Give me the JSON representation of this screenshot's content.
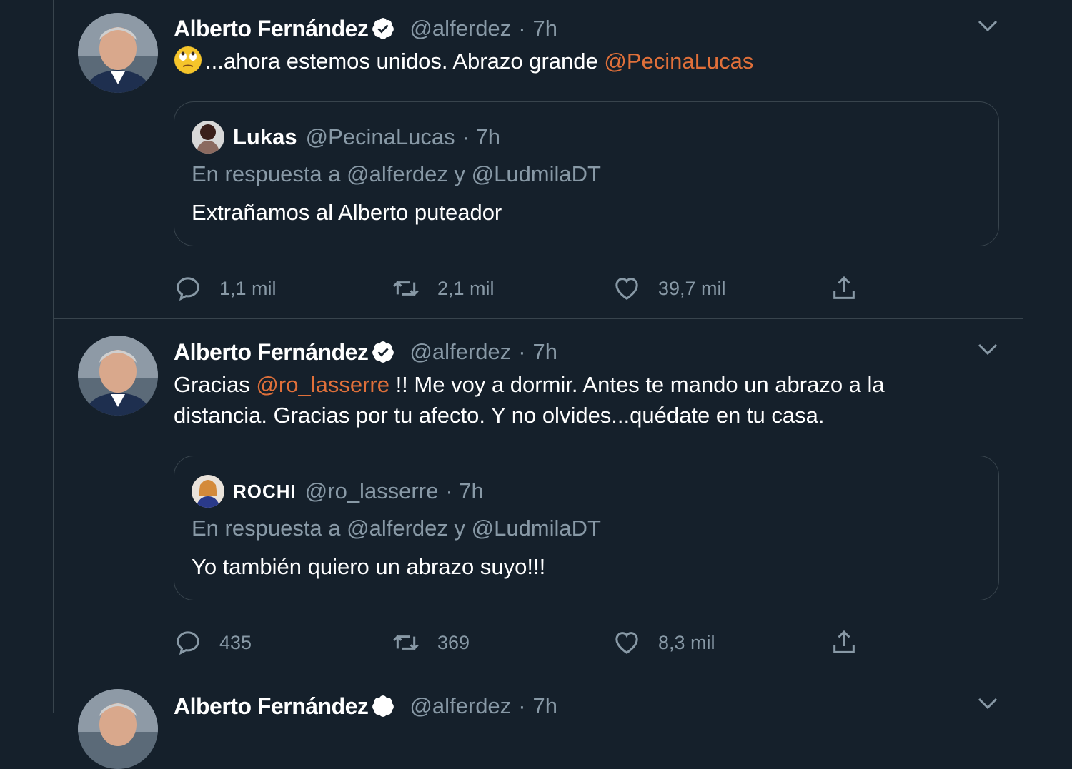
{
  "colors": {
    "background": "#15202b",
    "border": "#38444d",
    "muted": "#8899a6",
    "mention": "#e0703a",
    "verified_badge": "#ffffff"
  },
  "tweets": [
    {
      "author": "Alberto Fernández",
      "handle": "@alferdez",
      "dot": "·",
      "time": "7h",
      "text_before": "...ahora estemos unidos. Abrazo grande ",
      "mention": "@PecinaLucas",
      "emoji": "face-with-rolling-eyes",
      "quote": {
        "name": "Lukas",
        "handle": "@PecinaLucas",
        "time": "· 7h",
        "reply": "En respuesta a @alferdez y @LudmilaDT",
        "text": "Extrañamos al Alberto puteador"
      },
      "actions": {
        "replies": "1,1 mil",
        "retweets": "2,1 mil",
        "likes": "39,7 mil"
      }
    },
    {
      "author": "Alberto Fernández",
      "handle": "@alferdez",
      "dot": "·",
      "time": "7h",
      "text_before": "Gracias ",
      "mention": "@ro_lasserre",
      "text_after": " !! Me voy a dormir. Antes te mando un abrazo a la distancia. Gracias por tu afecto. Y no olvides...quédate en tu casa.",
      "quote": {
        "name": "ROCHI",
        "handle": "@ro_lasserre",
        "time": "· 7h",
        "reply": "En respuesta a @alferdez y @LudmilaDT",
        "text": "Yo también quiero un abrazo suyo!!!"
      },
      "actions": {
        "replies": "435",
        "retweets": "369",
        "likes": "8,3 mil"
      }
    },
    {
      "author": "Alberto Fernández",
      "handle": "@alferdez",
      "dot": "·",
      "time": "7h"
    }
  ]
}
